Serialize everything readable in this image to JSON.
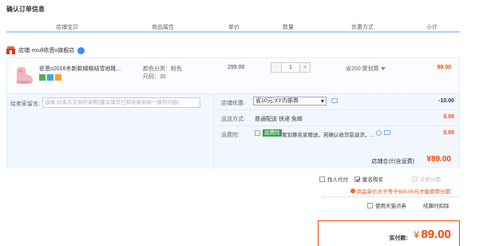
{
  "page_title": "确认订单信息",
  "columns": [
    "店铺宝贝",
    "商品属性",
    "单价",
    "数量",
    "优惠方式",
    "小计"
  ],
  "shop": {
    "label": "店铺:",
    "name": "exull依恩o旗舰店"
  },
  "item": {
    "title": "依恩o2016冬新款蝴蝶结雪地靴...",
    "attr_color": "颜色分类：粉色",
    "attr_size": "尺码：35",
    "unit_price": "299.00",
    "quantity": "1",
    "qty_minus": "-",
    "qty_plus": "+",
    "promo": "省200:聚划算",
    "subtotal": "99.00"
  },
  "message": {
    "label": "给卖家留言:",
    "placeholder": "选填:对本次交易的说明(建议填写已和卖家协商一致的内容)"
  },
  "shop_coupon": {
    "label": "店铺优惠:",
    "selected": "省10元:XY内部券",
    "amount": "-10.00"
  },
  "delivery": {
    "label": "运送方式:",
    "text": "普通配送 快递 免邮",
    "amount": "0.00"
  },
  "insurance": {
    "label": "运费险:",
    "tag": "运费险",
    "text": "聚划算卖家赠送，若确认收货前退货，...",
    "amount": "0.00"
  },
  "shop_total": {
    "label": "店铺合计(含运费)",
    "value": "¥89.00"
  },
  "options": {
    "anonymous_friend": "找人代付",
    "anonymous_buy": "匿名购买",
    "huabei": "花呗分期",
    "huabei_note": "商品单价大于等于600.00元才能使用分期",
    "tmall_points": "使用天猫点券",
    "points_note": "结算时扣除"
  },
  "final": {
    "label": "实付款:",
    "yen": "¥",
    "value": "89.00"
  },
  "colors": {
    "accent": "#ff4400",
    "header_line": "#b2d1ff",
    "panel_bg": "#f2f7ff"
  }
}
